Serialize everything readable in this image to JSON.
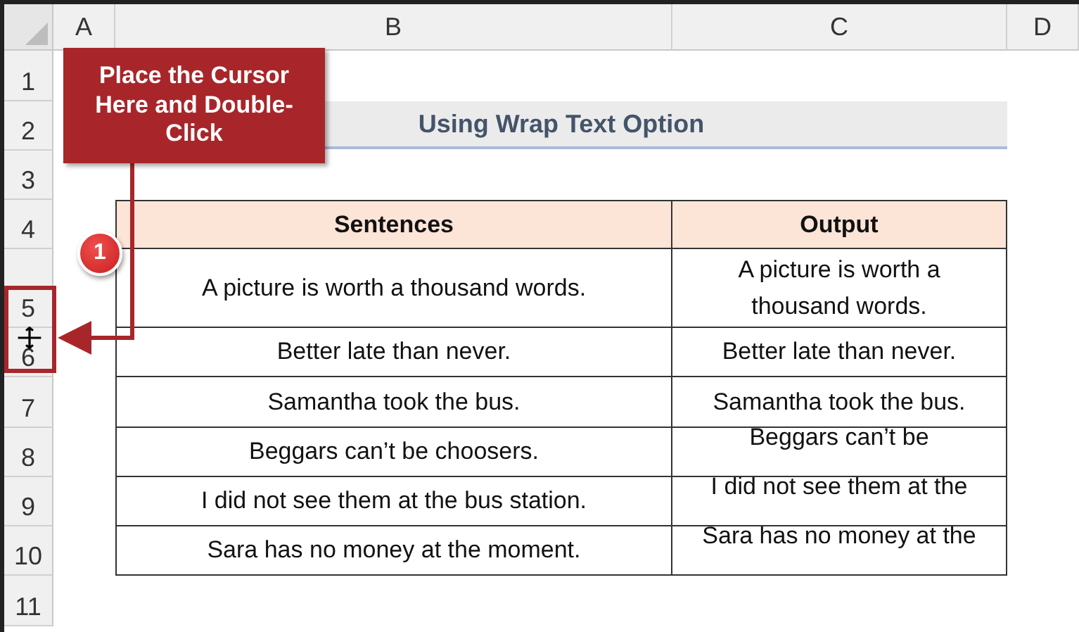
{
  "sheet": {
    "columns": [
      "A",
      "B",
      "C",
      "D"
    ],
    "rows": [
      "1",
      "2",
      "3",
      "4",
      "5",
      "6",
      "7",
      "8",
      "9",
      "10",
      "11"
    ]
  },
  "title": "Using Wrap Text Option",
  "table": {
    "columns": [
      "Sentences",
      "Output"
    ],
    "rows": [
      {
        "sentence": "A picture is worth a thousand words.",
        "output": "A picture is worth a thousand words.",
        "clipped": false
      },
      {
        "sentence": "Better late than never.",
        "output": "Better late than never.",
        "clipped": false
      },
      {
        "sentence": "Samantha took the bus.",
        "output": "Samantha took the bus.",
        "clipped": false
      },
      {
        "sentence": "Beggars can’t be choosers.",
        "output": "Beggars can’t be",
        "clipped": true
      },
      {
        "sentence": "I did not see them at the bus station.",
        "output": "I did not see them at the",
        "clipped": true
      },
      {
        "sentence": "Sara has no money at the moment.",
        "output": "Sara has no money at the",
        "clipped": true
      }
    ]
  },
  "callout": {
    "text": "Place the Cursor Here and Double-Click",
    "step": "1"
  }
}
